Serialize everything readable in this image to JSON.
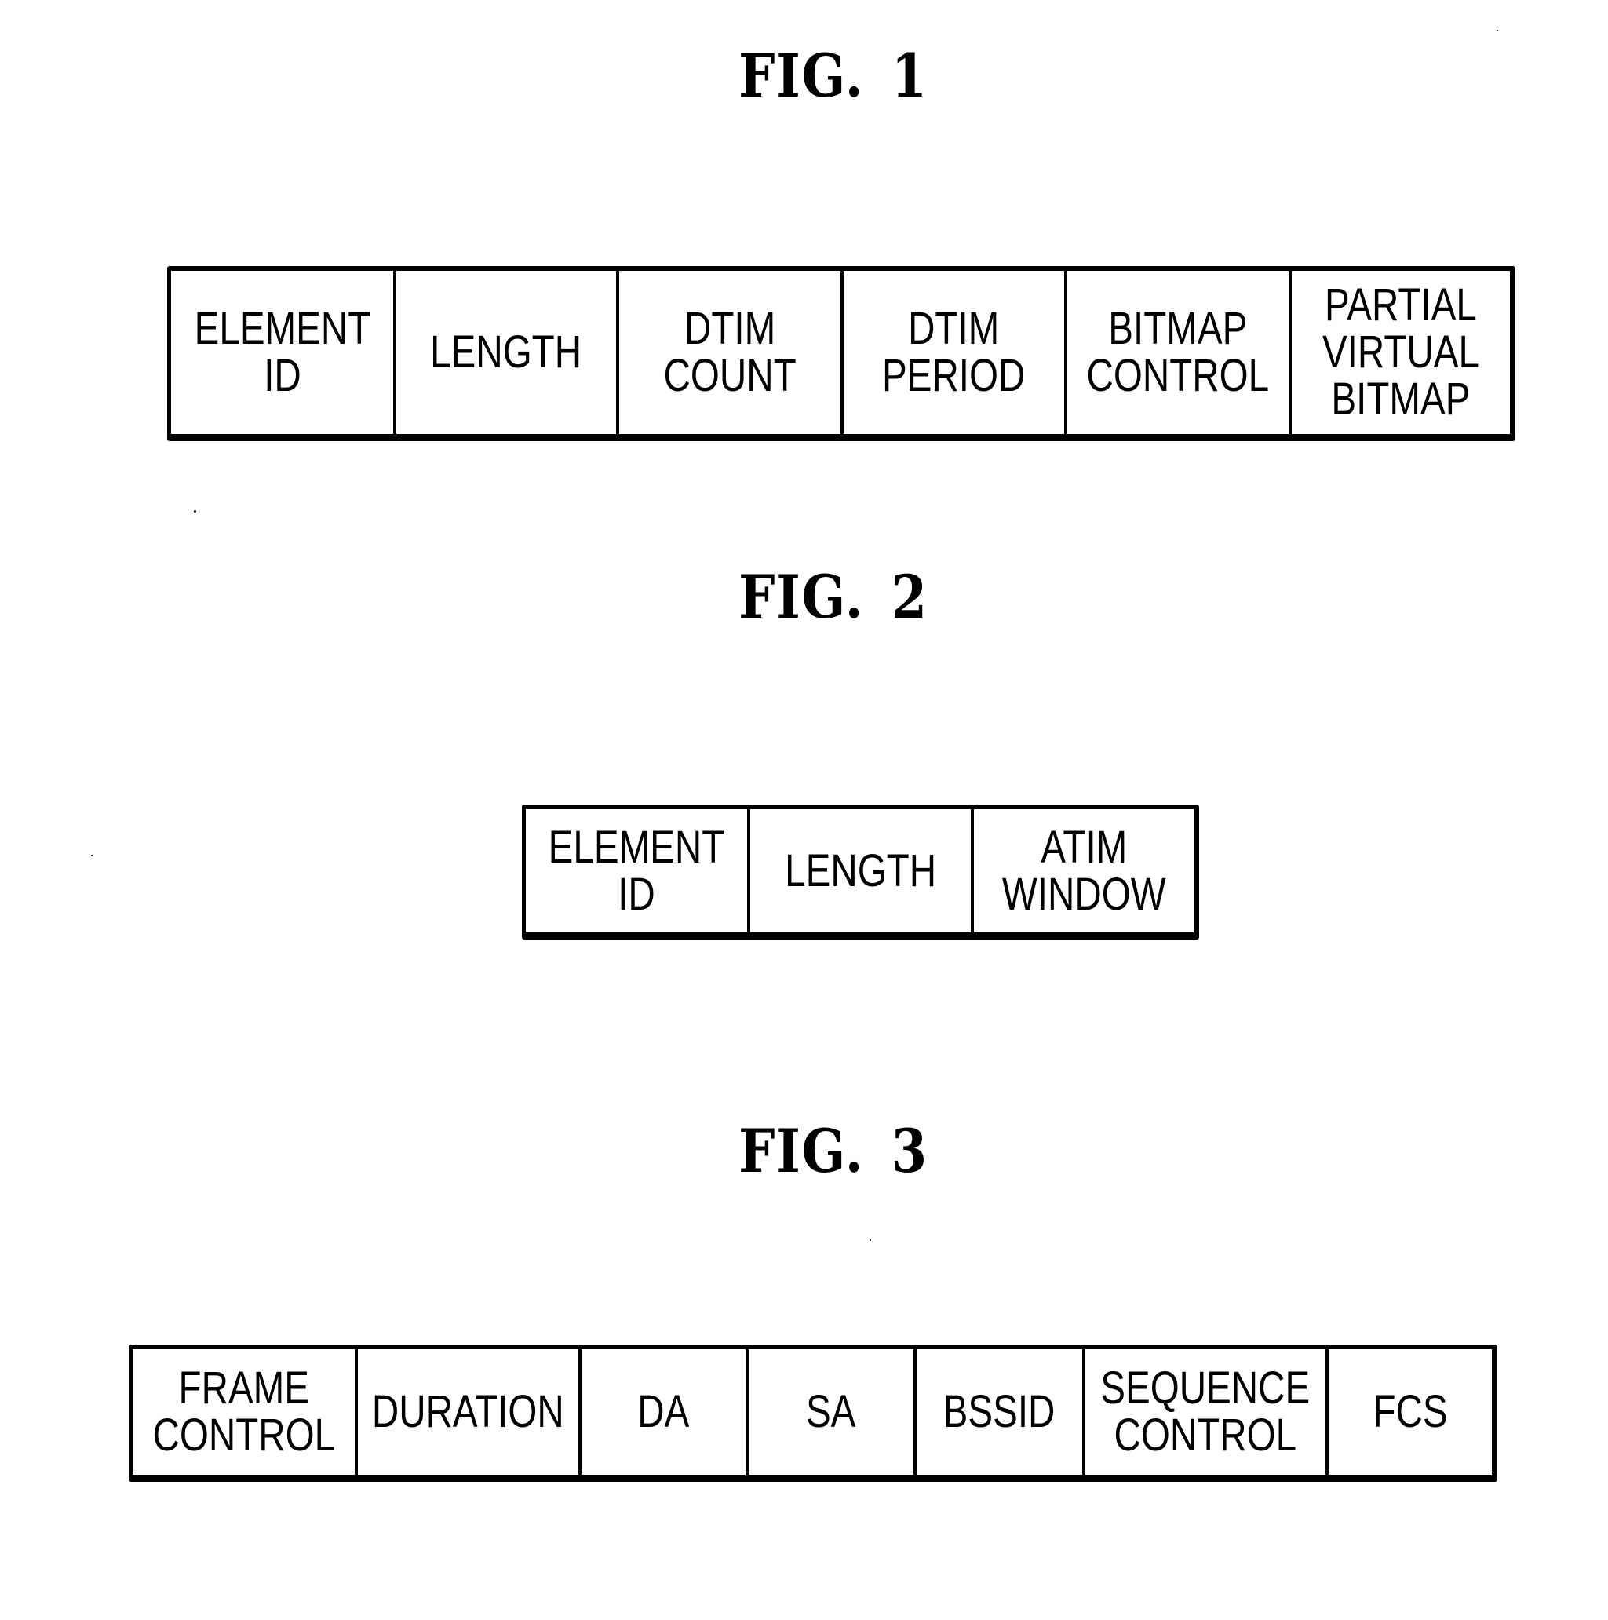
{
  "figures": [
    {
      "title_prefix": "FIG.",
      "number": "1",
      "fields": [
        {
          "label": "ELEMENT\nID"
        },
        {
          "label": "LENGTH"
        },
        {
          "label": "DTIM\nCOUNT"
        },
        {
          "label": "DTIM\nPERIOD"
        },
        {
          "label": "BITMAP\nCONTROL"
        },
        {
          "label": "PARTIAL\nVIRTUAL\nBITMAP"
        }
      ]
    },
    {
      "title_prefix": "FIG.",
      "number": "2",
      "fields": [
        {
          "label": "ELEMENT\nID"
        },
        {
          "label": "LENGTH"
        },
        {
          "label": "ATIM\nWINDOW"
        }
      ]
    },
    {
      "title_prefix": "FIG.",
      "number": "3",
      "fields": [
        {
          "label": "FRAME\nCONTROL"
        },
        {
          "label": "DURATION"
        },
        {
          "label": "DA"
        },
        {
          "label": "SA"
        },
        {
          "label": "BSSID"
        },
        {
          "label": "SEQUENCE\nCONTROL"
        },
        {
          "label": "FCS"
        }
      ]
    }
  ]
}
